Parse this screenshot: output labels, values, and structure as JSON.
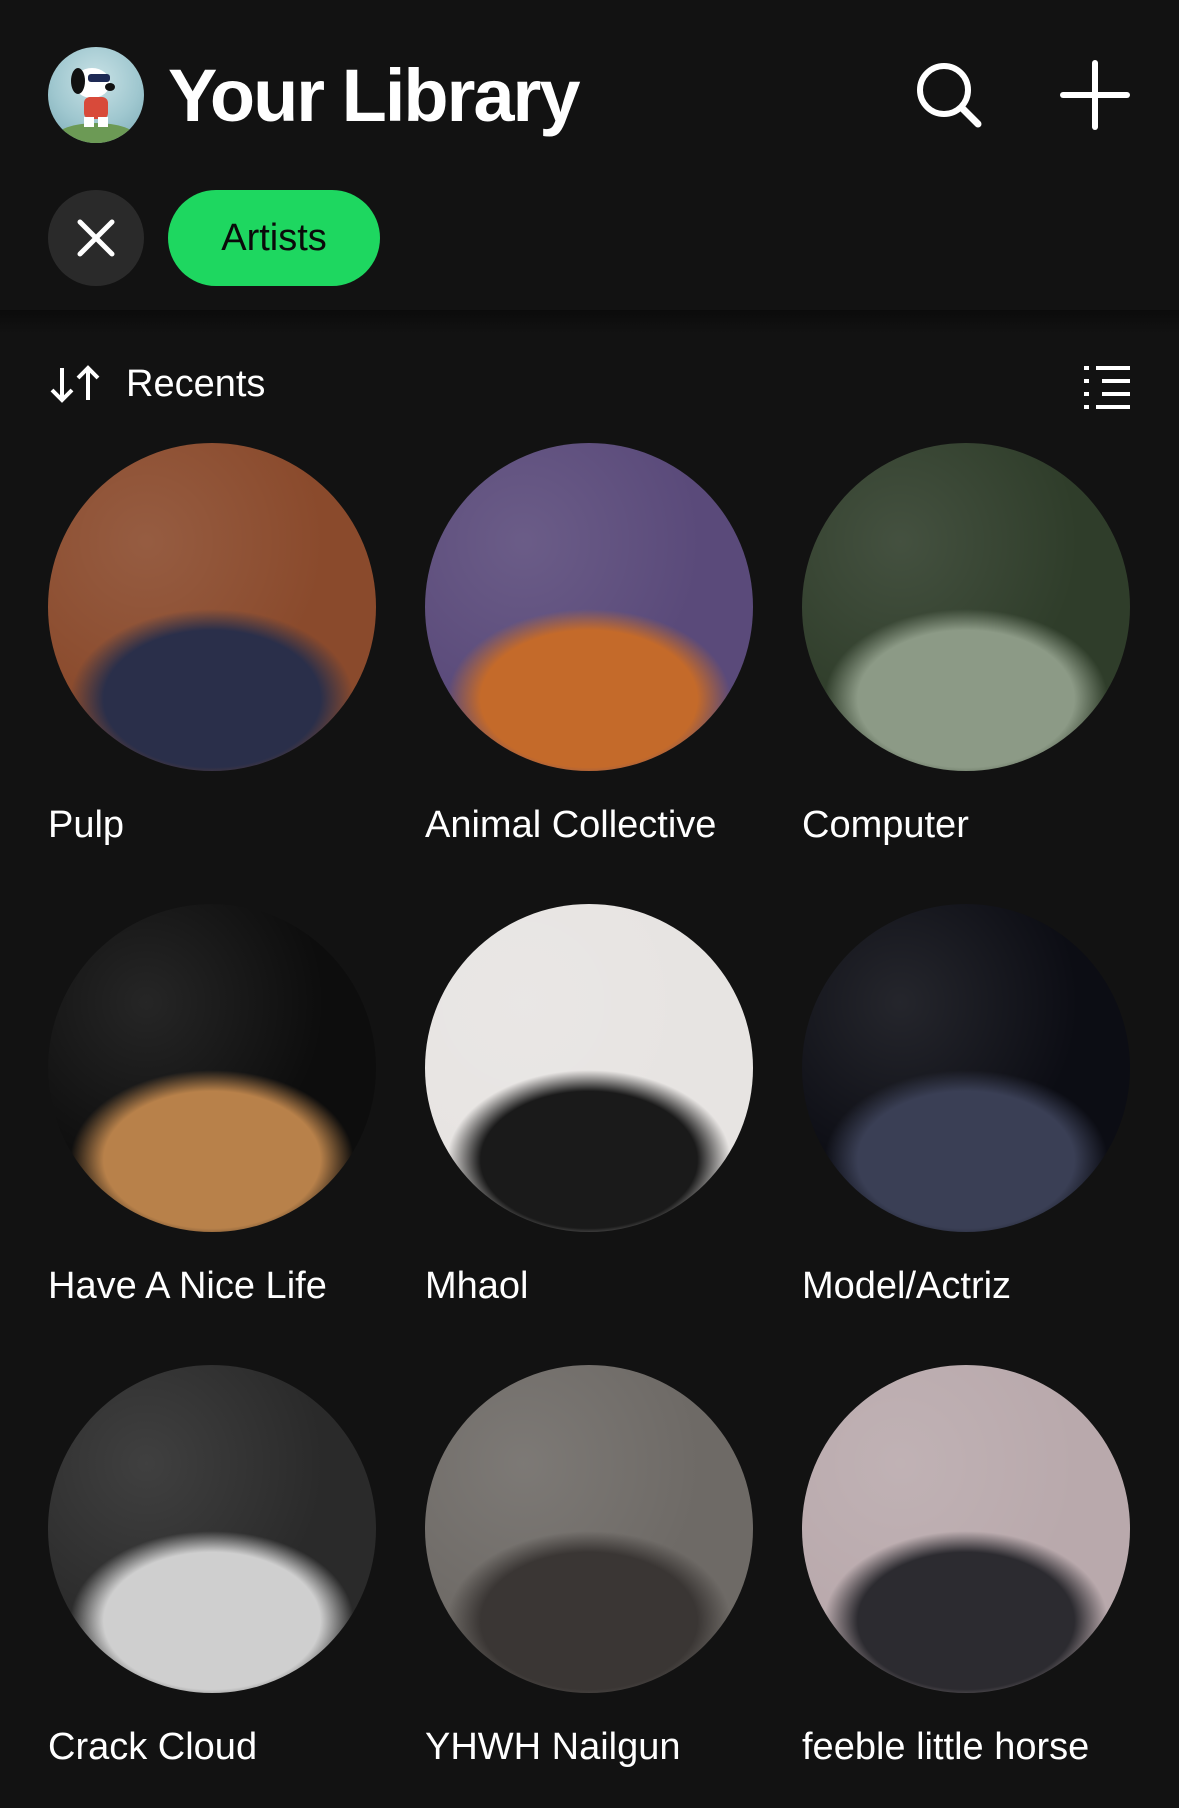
{
  "header": {
    "title": "Your Library"
  },
  "filters": {
    "active_chip": "Artists"
  },
  "sort": {
    "label": "Recents"
  },
  "artists": [
    {
      "name": "Pulp",
      "bg": "#8a4a2c",
      "fg": "#2a2f4a"
    },
    {
      "name": "Animal Collective",
      "bg": "#5a4a7a",
      "fg": "#c46a2a"
    },
    {
      "name": "Computer",
      "bg": "#2f3d2a",
      "fg": "#8c9a86"
    },
    {
      "name": "Have A Nice Life",
      "bg": "#0d0d0d",
      "fg": "#b8814a"
    },
    {
      "name": "Mhaol",
      "bg": "#e7e4e2",
      "fg": "#1a1a1a"
    },
    {
      "name": "Model/Actriz",
      "bg": "#0c0d14",
      "fg": "#3a3f55"
    },
    {
      "name": "Crack Cloud",
      "bg": "#2a2a2a",
      "fg": "#cfcfcf"
    },
    {
      "name": "YHWH Nailgun",
      "bg": "#6e6a66",
      "fg": "#3a3634"
    },
    {
      "name": "feeble little horse",
      "bg": "#b9a9ac",
      "fg": "#2c2b30"
    }
  ],
  "colors": {
    "background": "#121212",
    "accent": "#1ed760",
    "chip_grey": "#2a2a2a",
    "text": "#ffffff"
  },
  "icons": [
    "avatar-snoopy",
    "search-icon",
    "plus-icon",
    "close-icon",
    "sort-arrows-icon",
    "list-view-icon"
  ]
}
